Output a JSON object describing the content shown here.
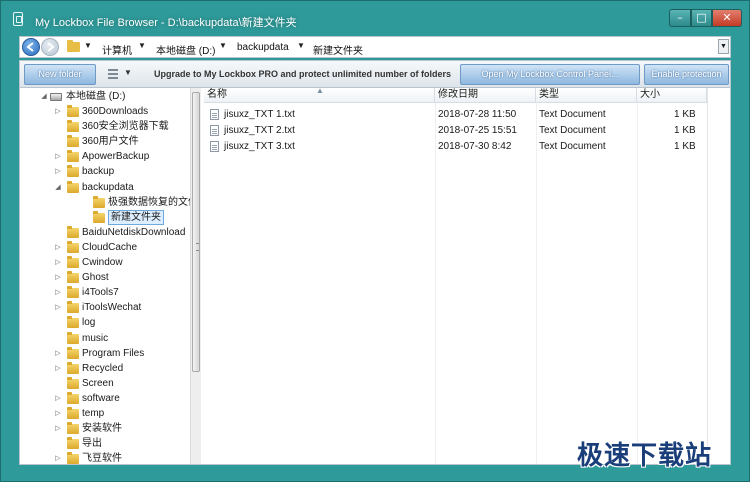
{
  "window": {
    "title": "My Lockbox File Browser - D:\\backupdata\\新建文件夹",
    "min_glyph": "–",
    "max_glyph": "□",
    "close_glyph": "✕"
  },
  "address": {
    "crumbs": [
      "计算机",
      "本地磁盘 (D:)",
      "backupdata",
      "新建文件夹"
    ]
  },
  "toolbar": {
    "new_folder": "New folder",
    "promo": "Upgrade to My Lockbox PRO and protect unlimited number of folders",
    "open_panel": "Open My Lockbox Control Panel...",
    "enable_protection": "Enable protection"
  },
  "tree": {
    "root": "本地磁盘 (D:)",
    "items": [
      {
        "label": "360Downloads",
        "expandable": true
      },
      {
        "label": "360安全浏览器下载",
        "expandable": false
      },
      {
        "label": "360用户文件",
        "expandable": false
      },
      {
        "label": "ApowerBackup",
        "expandable": true
      },
      {
        "label": "backup",
        "expandable": true
      },
      {
        "label": "backupdata",
        "expandable": true,
        "expanded": true
      },
      {
        "label": "极强数据恢复的文件",
        "child": true
      },
      {
        "label": "新建文件夹",
        "child": true,
        "selected": true
      },
      {
        "label": "BaiduNetdiskDownload",
        "expandable": false
      },
      {
        "label": "CloudCache",
        "expandable": true
      },
      {
        "label": "Cwindow",
        "expandable": true
      },
      {
        "label": "Ghost",
        "expandable": true
      },
      {
        "label": "i4Tools7",
        "expandable": true
      },
      {
        "label": "iToolsWechat",
        "expandable": true
      },
      {
        "label": "log",
        "expandable": false
      },
      {
        "label": "music",
        "expandable": false
      },
      {
        "label": "Program Files",
        "expandable": true
      },
      {
        "label": "Recycled",
        "expandable": true
      },
      {
        "label": "Screen",
        "expandable": false
      },
      {
        "label": "software",
        "expandable": true
      },
      {
        "label": "temp",
        "expandable": true
      },
      {
        "label": "安装软件",
        "expandable": true
      },
      {
        "label": "导出",
        "expandable": false
      },
      {
        "label": "飞豆软件",
        "expandable": true
      }
    ]
  },
  "list": {
    "columns": [
      "名称",
      "修改日期",
      "类型",
      "大小"
    ],
    "rows": [
      {
        "name": "jisuxz_TXT 1.txt",
        "date": "2018-07-28 11:50",
        "type": "Text Document",
        "size": "1 KB"
      },
      {
        "name": "jisuxz_TXT 2.txt",
        "date": "2018-07-25 15:51",
        "type": "Text Document",
        "size": "1 KB"
      },
      {
        "name": "jisuxz_TXT 3.txt",
        "date": "2018-07-30 8:42",
        "type": "Text Document",
        "size": "1 KB"
      }
    ]
  },
  "watermark": "极速下载站"
}
